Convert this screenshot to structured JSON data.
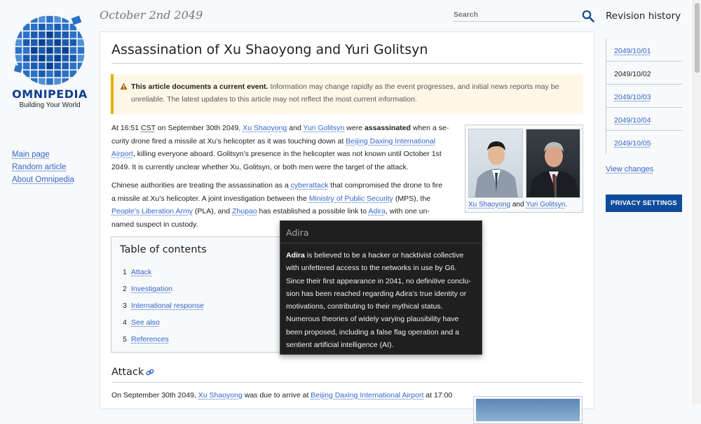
{
  "logo": {
    "wordmark": "OMNIPEDIA",
    "tagline": "Building Your World"
  },
  "left_nav": [
    {
      "label": "Main page"
    },
    {
      "label": "Random article"
    },
    {
      "label": "About Omnipedia"
    }
  ],
  "header": {
    "date": "October 2nd 2049",
    "search_placeholder": "Search"
  },
  "article": {
    "title": "Assassination of Xu Shaoyong and Yuri Golitsyn",
    "notice": {
      "bold": "This article documents a current event.",
      "text": " Information may change rapidly as the event progresses, and initial news reports may be unreliable. The latest updates to this article may not reflect the most current information."
    },
    "p1": {
      "t1": "At 16:51 ",
      "cst": "CST",
      "t2": " on September 30th 2049, ",
      "xu": "Xu Shaoyong",
      "t3": " and ",
      "yuri": "Yuri Golitsyn",
      "t4": " were ",
      "assassinated": "assassinated",
      "t5": " when a se-",
      "t6": "curity drone fired a missile at Xu’s helicopter as it was touching down at ",
      "airport_a": "Beijing Daxing International",
      "airport_b": "Airport",
      "t7": ", killing everyone aboard. Golitsyn’s presence in the helicopter was not known until October 1st",
      "t8": "2049. It is currently unclear whether Xu, Golitsyn, or both men were the target of the attack."
    },
    "p2": {
      "t1": "Chinese authorities are treating the assassination as a ",
      "cyberattack": "cyberattack",
      "t2": " that compromised the drone to fire",
      "t3": "a missile at Xu’s helicopter. A joint investigation between the ",
      "mps": "Ministry of Public Security",
      "t4": " (MPS), the",
      "pla": "People’s Liberation Army",
      "t5": " (PLA), and ",
      "zhupao": "Zhupao",
      "t6": " has established a possible link to ",
      "adira": "Adira",
      "t7": ", with one un-",
      "t8": "named suspect in custody."
    },
    "infobox": {
      "caption_xu": "Xu Shaoyong",
      "caption_and": " and ",
      "caption_yuri": "Yuri Golitsyn",
      "caption_end": "."
    },
    "toc": {
      "title": "Table of contents",
      "items": [
        {
          "num": "1",
          "label": "Attack"
        },
        {
          "num": "2",
          "label": "Investigation"
        },
        {
          "num": "3",
          "label": "International response"
        },
        {
          "num": "4",
          "label": "See also"
        },
        {
          "num": "5",
          "label": "References"
        }
      ]
    },
    "attack": {
      "heading": "Attack",
      "t1": "On September 30th 2049, ",
      "xu": "Xu Shaoyong",
      "t2": " was due to arrive at ",
      "airport": "Beijing Daxing International Airport",
      "t3": " at 17:00"
    }
  },
  "tooltip": {
    "title": "Adira",
    "bold": "Adira",
    "l1": " is believed to be a hacker or hacktivist collective",
    "l2": "with unfettered access to the networks in use by G6.",
    "l3": "Since their first appearance in 2041, no definitive conclu-",
    "l4": "sion has been reached regarding Adira’s true identity or",
    "l5": "motivations, contributing to their mythical status.",
    "l6": "Numerous theories of widely varying plausibility have",
    "l7": "been proposed, including a false flag operation and a",
    "l8": "sentient artificial intelligence (AI)."
  },
  "revision_history": {
    "title": "Revision history",
    "items": [
      {
        "label": "2049/10/01",
        "current": false
      },
      {
        "label": "2049/10/02",
        "current": true
      },
      {
        "label": "2049/10/03",
        "current": false
      },
      {
        "label": "2049/10/04",
        "current": false
      },
      {
        "label": "2049/10/05",
        "current": false
      }
    ],
    "view_changes": "View changes",
    "privacy_button": "PRIVACY SETTINGS"
  },
  "colors": {
    "link": "#3366cc",
    "brand": "#0d3f8f",
    "notice_accent": "#edab00",
    "button": "#0f4c9c",
    "tooltip_bg": "#1f1f1f"
  }
}
